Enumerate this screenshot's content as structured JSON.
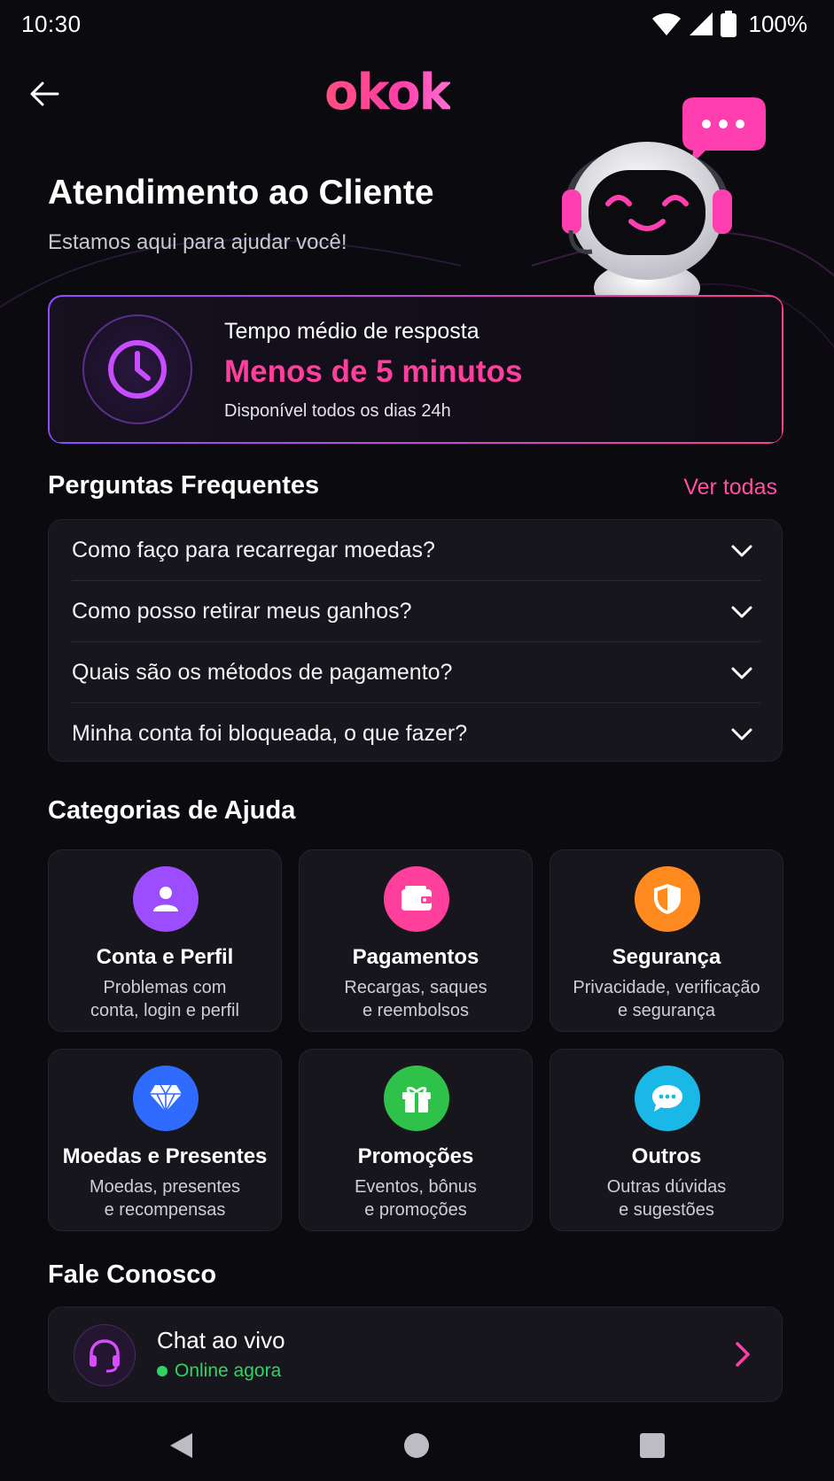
{
  "status_bar": {
    "time": "10:30",
    "battery": "100%"
  },
  "header": {
    "logo": "okok",
    "title": "Atendimento ao Cliente",
    "subtitle": "Estamos aqui para ajudar você!"
  },
  "response_card": {
    "label": "Tempo médio de resposta",
    "value": "Menos de 5 minutos",
    "note": "Disponível todos os dias 24h",
    "accent": "#ff3f9c"
  },
  "faq": {
    "title": "Perguntas Frequentes",
    "see_all": "Ver todas",
    "items": [
      {
        "question": "Como faço para recarregar moedas?"
      },
      {
        "question": "Como posso retirar meus ganhos?"
      },
      {
        "question": "Quais são os métodos de pagamento?"
      },
      {
        "question": "Minha conta foi bloqueada, o que fazer?"
      }
    ]
  },
  "categories": {
    "title": "Categorias de Ajuda",
    "items": [
      {
        "title": "Conta e Perfil",
        "desc": "Problemas com\nconta, login e perfil",
        "icon": "user-icon",
        "color": "#9b4dff"
      },
      {
        "title": "Pagamentos",
        "desc": "Recargas, saques\ne reembolsos",
        "icon": "wallet-icon",
        "color": "#ff3f9c"
      },
      {
        "title": "Segurança",
        "desc": "Privacidade, verificação\ne segurança",
        "icon": "shield-icon",
        "color": "#ff8a1f"
      },
      {
        "title": "Moedas e Presentes",
        "desc": "Moedas, presentes\ne recompensas",
        "icon": "diamond-icon",
        "color": "#2f6bff"
      },
      {
        "title": "Promoções",
        "desc": "Eventos, bônus\ne promoções",
        "icon": "gift-icon",
        "color": "#2fc24a"
      },
      {
        "title": "Outros",
        "desc": "Outras dúvidas\ne sugestões",
        "icon": "chat-bubble-icon",
        "color": "#19b8e6"
      }
    ]
  },
  "contact": {
    "title": "Fale Conosco",
    "chat_title": "Chat ao vivo",
    "chat_status": "Online agora",
    "status_color": "#2fd465"
  }
}
